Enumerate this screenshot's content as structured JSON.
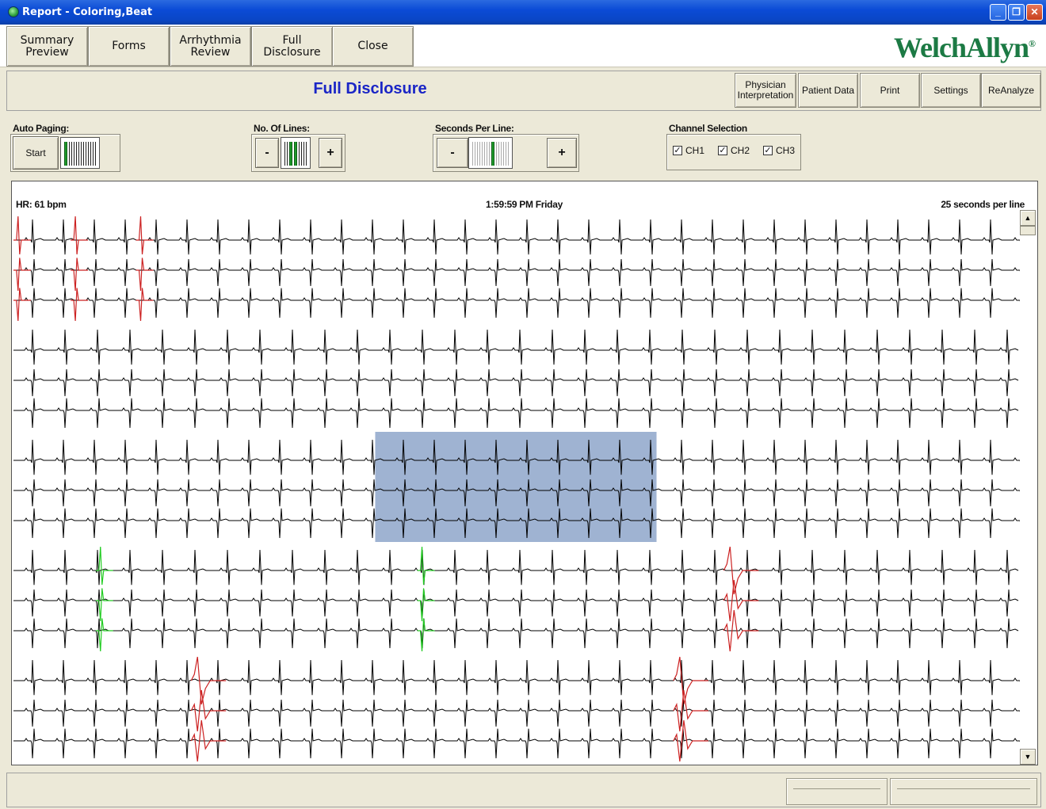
{
  "window": {
    "title": "Report - Coloring,Beat",
    "controls": [
      "minimize-icon",
      "maximize-icon",
      "close-icon"
    ]
  },
  "nav": {
    "buttons": [
      {
        "label": "Summary\nPreview"
      },
      {
        "label": "Forms"
      },
      {
        "label": "Arrhythmia\nReview"
      },
      {
        "label": "Full\nDisclosure"
      },
      {
        "label": "Close"
      }
    ],
    "logo": "WelchAllyn",
    "logo_mark": "®"
  },
  "header": {
    "title": "Full Disclosure",
    "buttons": [
      {
        "label": "Physician\nInterpretation"
      },
      {
        "label": "Patient Data"
      },
      {
        "label": "Print"
      },
      {
        "label": "Settings"
      },
      {
        "label": "ReAnalyze"
      }
    ]
  },
  "controls": {
    "auto_paging": {
      "label": "Auto Paging:",
      "start": "Start"
    },
    "lines": {
      "label": "No. Of Lines:",
      "minus": "-",
      "plus": "+"
    },
    "seconds": {
      "label": "Seconds Per Line:",
      "minus": "-",
      "plus": "+"
    },
    "channels": {
      "label": "Channel Selection",
      "items": [
        {
          "label": "CH1",
          "checked": true
        },
        {
          "label": "CH2",
          "checked": true
        },
        {
          "label": "CH3",
          "checked": true
        }
      ]
    }
  },
  "ecg": {
    "hr": "HR: 61 bpm",
    "time": "1:59:59 PM Friday",
    "rate": "25 seconds per line",
    "colors": {
      "normal": "#000000",
      "pvc": "#cc2222",
      "paced": "#22cc22",
      "selection": "#7f9ac3"
    },
    "strips": [
      {
        "red_beats": [
          0.003,
          0.06,
          0.125
        ],
        "green_beats": [],
        "red_wide": []
      },
      {
        "red_beats": [],
        "green_beats": [],
        "red_wide": []
      },
      {
        "red_beats": [],
        "green_beats": [],
        "red_wide": [],
        "selection": [
          0.36,
          0.64
        ]
      },
      {
        "red_beats": [],
        "green_beats": [
          0.085,
          0.405
        ],
        "red_wide": [
          0.71
        ]
      },
      {
        "red_beats": [],
        "green_beats": [],
        "red_wide": [
          0.18,
          0.66
        ]
      }
    ]
  }
}
